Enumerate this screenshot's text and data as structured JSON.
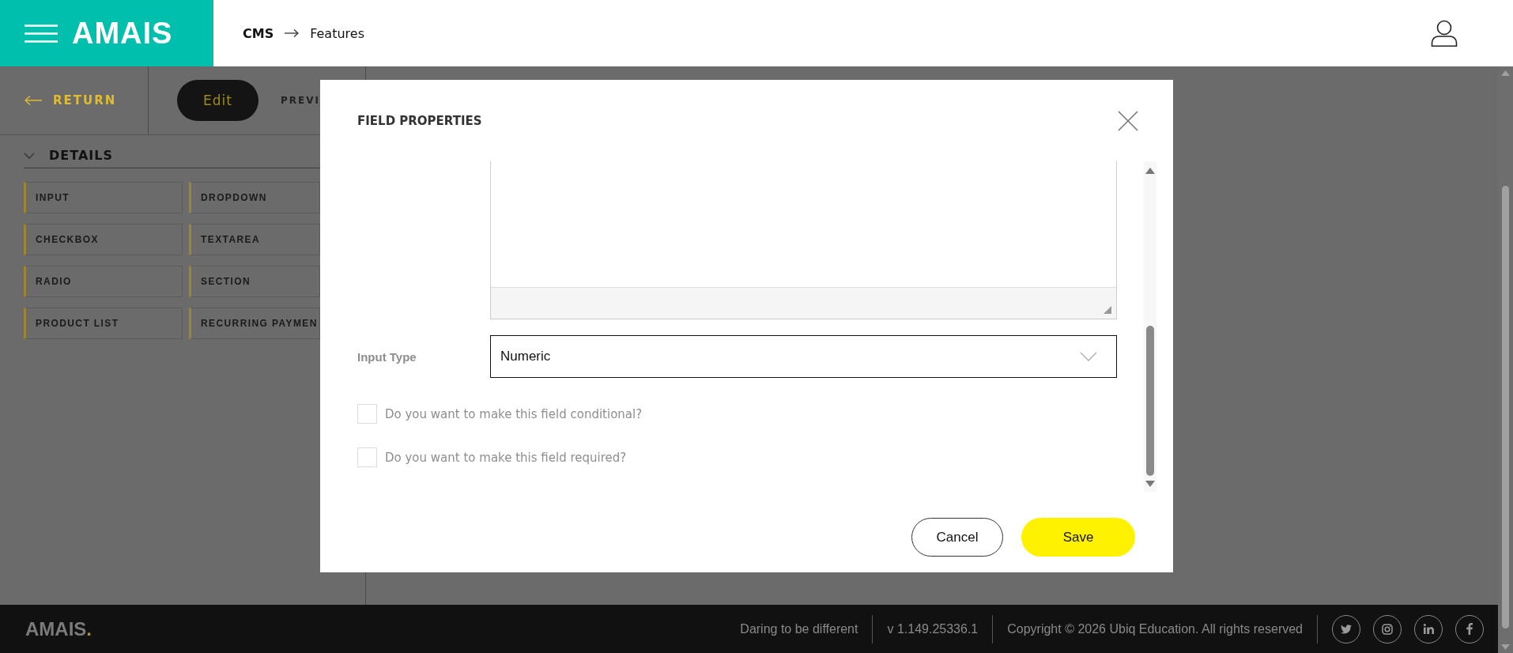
{
  "header": {
    "logo": "AMAIS",
    "breadcrumb": [
      {
        "label": "CMS",
        "current": false
      },
      {
        "label": "Features",
        "current": true
      }
    ]
  },
  "toolbar": {
    "return_label": "RETURN",
    "tabs": [
      {
        "label": "Edit",
        "selected": true
      },
      {
        "label": "PREVI",
        "selected": false
      }
    ]
  },
  "palette": {
    "section": {
      "title": "DETAILS",
      "expanded": true
    },
    "items": [
      "INPUT",
      "DROPDOWN",
      "CHECKBOX",
      "TEXTAREA",
      "RADIO",
      "SECTION",
      "PRODUCT LIST",
      "RECURRING PAYMEN"
    ]
  },
  "modal": {
    "title": "FIELD PROPERTIES",
    "fields": [
      {
        "label": "Input Type",
        "value": "Numeric"
      }
    ],
    "options": [
      {
        "label": "Do you want to make this field conditional?",
        "checked": false
      },
      {
        "label": "Do you want to make this field required?",
        "checked": false
      }
    ],
    "buttons": [
      {
        "label": "Cancel",
        "kind": "secondary"
      },
      {
        "label": "Save",
        "kind": "primary"
      }
    ]
  },
  "footer": {
    "logo": "AMAIS",
    "logo_mark": ".",
    "tagline": "Daring to be different",
    "version": "v 1.149.25336.1",
    "copyright": "Copyright © 2026 Ubiq Education. All rights reserved",
    "social": [
      {
        "kind": "twitter"
      },
      {
        "kind": "instagram"
      },
      {
        "kind": "linkedin"
      },
      {
        "kind": "facebook"
      }
    ]
  }
}
